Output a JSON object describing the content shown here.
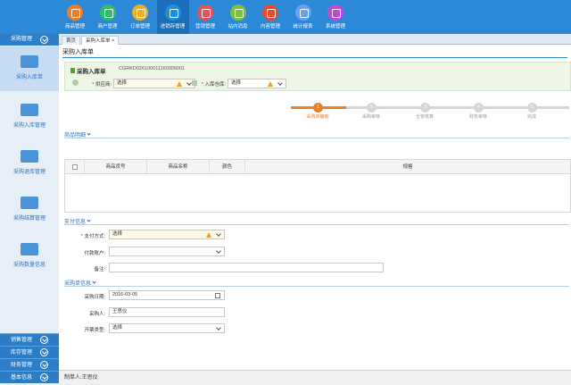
{
  "modules": [
    {
      "label": "商品管理",
      "color": "#f07e22"
    },
    {
      "label": "商户管理",
      "color": "#2dbe6c"
    },
    {
      "label": "订单管理",
      "color": "#f0b020"
    },
    {
      "label": "进销存管理",
      "color": "#1e8fe0"
    },
    {
      "label": "营销管理",
      "color": "#e8505a"
    },
    {
      "label": "站内消息",
      "color": "#7ac142"
    },
    {
      "label": "内容管理",
      "color": "#e84a2e"
    },
    {
      "label": "统计报表",
      "color": "#6aa0f0"
    },
    {
      "label": "系统管理",
      "color": "#c04ad8"
    }
  ],
  "sidebar": {
    "header": "采购管理",
    "items": [
      {
        "label": "采购入库单"
      },
      {
        "label": "采购入库管理"
      },
      {
        "label": "采购退库管理"
      },
      {
        "label": "采购结算管理"
      },
      {
        "label": "采购数量信息"
      }
    ],
    "bottom": [
      "销售管理",
      "库存管理",
      "财务管理",
      "基本信息"
    ]
  },
  "tabs": [
    {
      "label": "首页"
    },
    {
      "label": "采购入库单"
    }
  ],
  "page": {
    "title": "采购入库单",
    "order_title": "采购入库单",
    "order_no": "CGRKD02610001116030500​1",
    "supplier_label": "供应商:",
    "supplier_value": "选择",
    "warehouse_label": "入库仓库:",
    "warehouse_value": "选择"
  },
  "steps": [
    {
      "num": "1",
      "label": "采购单编制"
    },
    {
      "num": "2",
      "label": "采购审核"
    },
    {
      "num": "3",
      "label": "仓管核算"
    },
    {
      "num": "4",
      "label": "财务审核"
    },
    {
      "num": "5",
      "label": "完成"
    }
  ],
  "goods": {
    "title": "商品明细",
    "columns": [
      "商品货号",
      "商品名称",
      "颜色",
      "规格"
    ]
  },
  "payment": {
    "title": "支付信息",
    "method_label": "支付方式:",
    "method_value": "选择",
    "account_label": "付款账户:",
    "account_value": "",
    "remark_label": "备注:",
    "remark_value": ""
  },
  "purchase": {
    "title": "采购单信息",
    "date_label": "采购日期:",
    "date_value": "2016-03-05",
    "buyer_label": "采购人:",
    "buyer_value": "王思仪",
    "invoice_label": "开票类型:",
    "invoice_value": "选择"
  },
  "footer": {
    "maker": "制单人:王思仪"
  }
}
